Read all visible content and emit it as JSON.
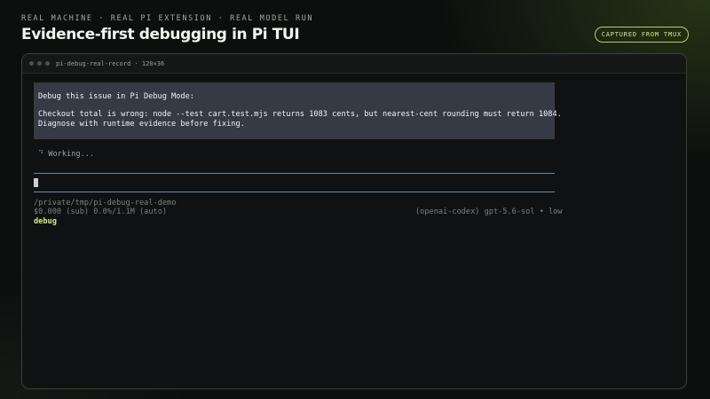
{
  "header": {
    "kicker": "REAL MACHINE · REAL PI EXTENSION · REAL MODEL RUN",
    "title": "Evidence-first debugging in Pi TUI",
    "badge": "CAPTURED FROM TMUX"
  },
  "window": {
    "title": "pi-debug-real-record · 120×36"
  },
  "terminal": {
    "prompt_lines": [
      "Debug this issue in Pi Debug Mode:",
      "Checkout total is wrong: node --test cart.test.mjs returns 1083 cents, but nearest-cent rounding must return 1084.",
      "Diagnose with runtime evidence before fixing."
    ],
    "spinner_glyph": "⠙",
    "status_text": "Working...",
    "input_value": "",
    "cwd": "/private/tmp/pi-debug-real-demo",
    "usage": "$0.000 (sub) 0.0%/1.1M (auto)",
    "model": "(openai-codex) gpt-5.6-sol • low",
    "mode": "debug"
  },
  "colors": {
    "accent": "#d6ea8a",
    "prompt_background": "#363a44",
    "rule": "#6d8fa8",
    "background": "#0d0f0e"
  }
}
